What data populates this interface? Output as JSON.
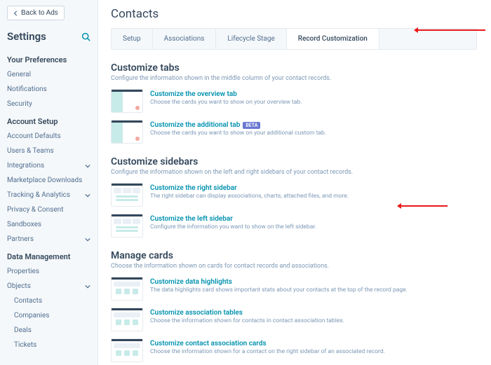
{
  "back_label": "Back to Ads",
  "sidebar_title": "Settings",
  "groups": {
    "prefs": {
      "title": "Your Preferences",
      "items": [
        "General",
        "Notifications",
        "Security"
      ]
    },
    "account": {
      "title": "Account Setup",
      "items": [
        "Account Defaults",
        "Users & Teams",
        "Integrations",
        "Marketplace Downloads",
        "Tracking & Analytics",
        "Privacy & Consent",
        "Sandboxes",
        "Partners"
      ]
    },
    "data": {
      "title": "Data Management",
      "items": [
        "Properties",
        "Objects"
      ],
      "sub": [
        "Contacts",
        "Companies",
        "Deals",
        "Tickets"
      ]
    }
  },
  "page_title": "Contacts",
  "tabs": [
    "Setup",
    "Associations",
    "Lifecycle Stage",
    "Record Customization"
  ],
  "sections": {
    "tabs_sec": {
      "title": "Customize tabs",
      "desc": "Configure the information shown in the middle column of your contact records.",
      "cards": [
        {
          "link": "Customize the overview tab",
          "desc": "Choose the cards you want to show on your overview tab."
        },
        {
          "link": "Customize the additional tab",
          "desc": "Choose the cards you want to show on your additional custom tab.",
          "badge": "BETA"
        }
      ]
    },
    "sidebars": {
      "title": "Customize sidebars",
      "desc": "Configure the information shown on the left and right sidebars of your contact records.",
      "cards": [
        {
          "link": "Customize the right sidebar",
          "desc": "The right sidebar can display associations, charts, attached files, and more."
        },
        {
          "link": "Customize the left sidebar",
          "desc": "Configure the information you want to show on the left sidebar."
        }
      ]
    },
    "cards": {
      "title": "Manage cards",
      "desc": "Choose the information shown on cards for contact records and associations.",
      "cards": [
        {
          "link": "Customize data highlights",
          "desc": "The data highlights card shows important stats about your contacts at the top of the record page."
        },
        {
          "link": "Customize association tables",
          "desc": "Choose the information shown for contacts in contact association tables."
        },
        {
          "link": "Customize contact association cards",
          "desc": "Choose the information shown for a contact on the right sidebar of an associated record."
        }
      ]
    }
  }
}
